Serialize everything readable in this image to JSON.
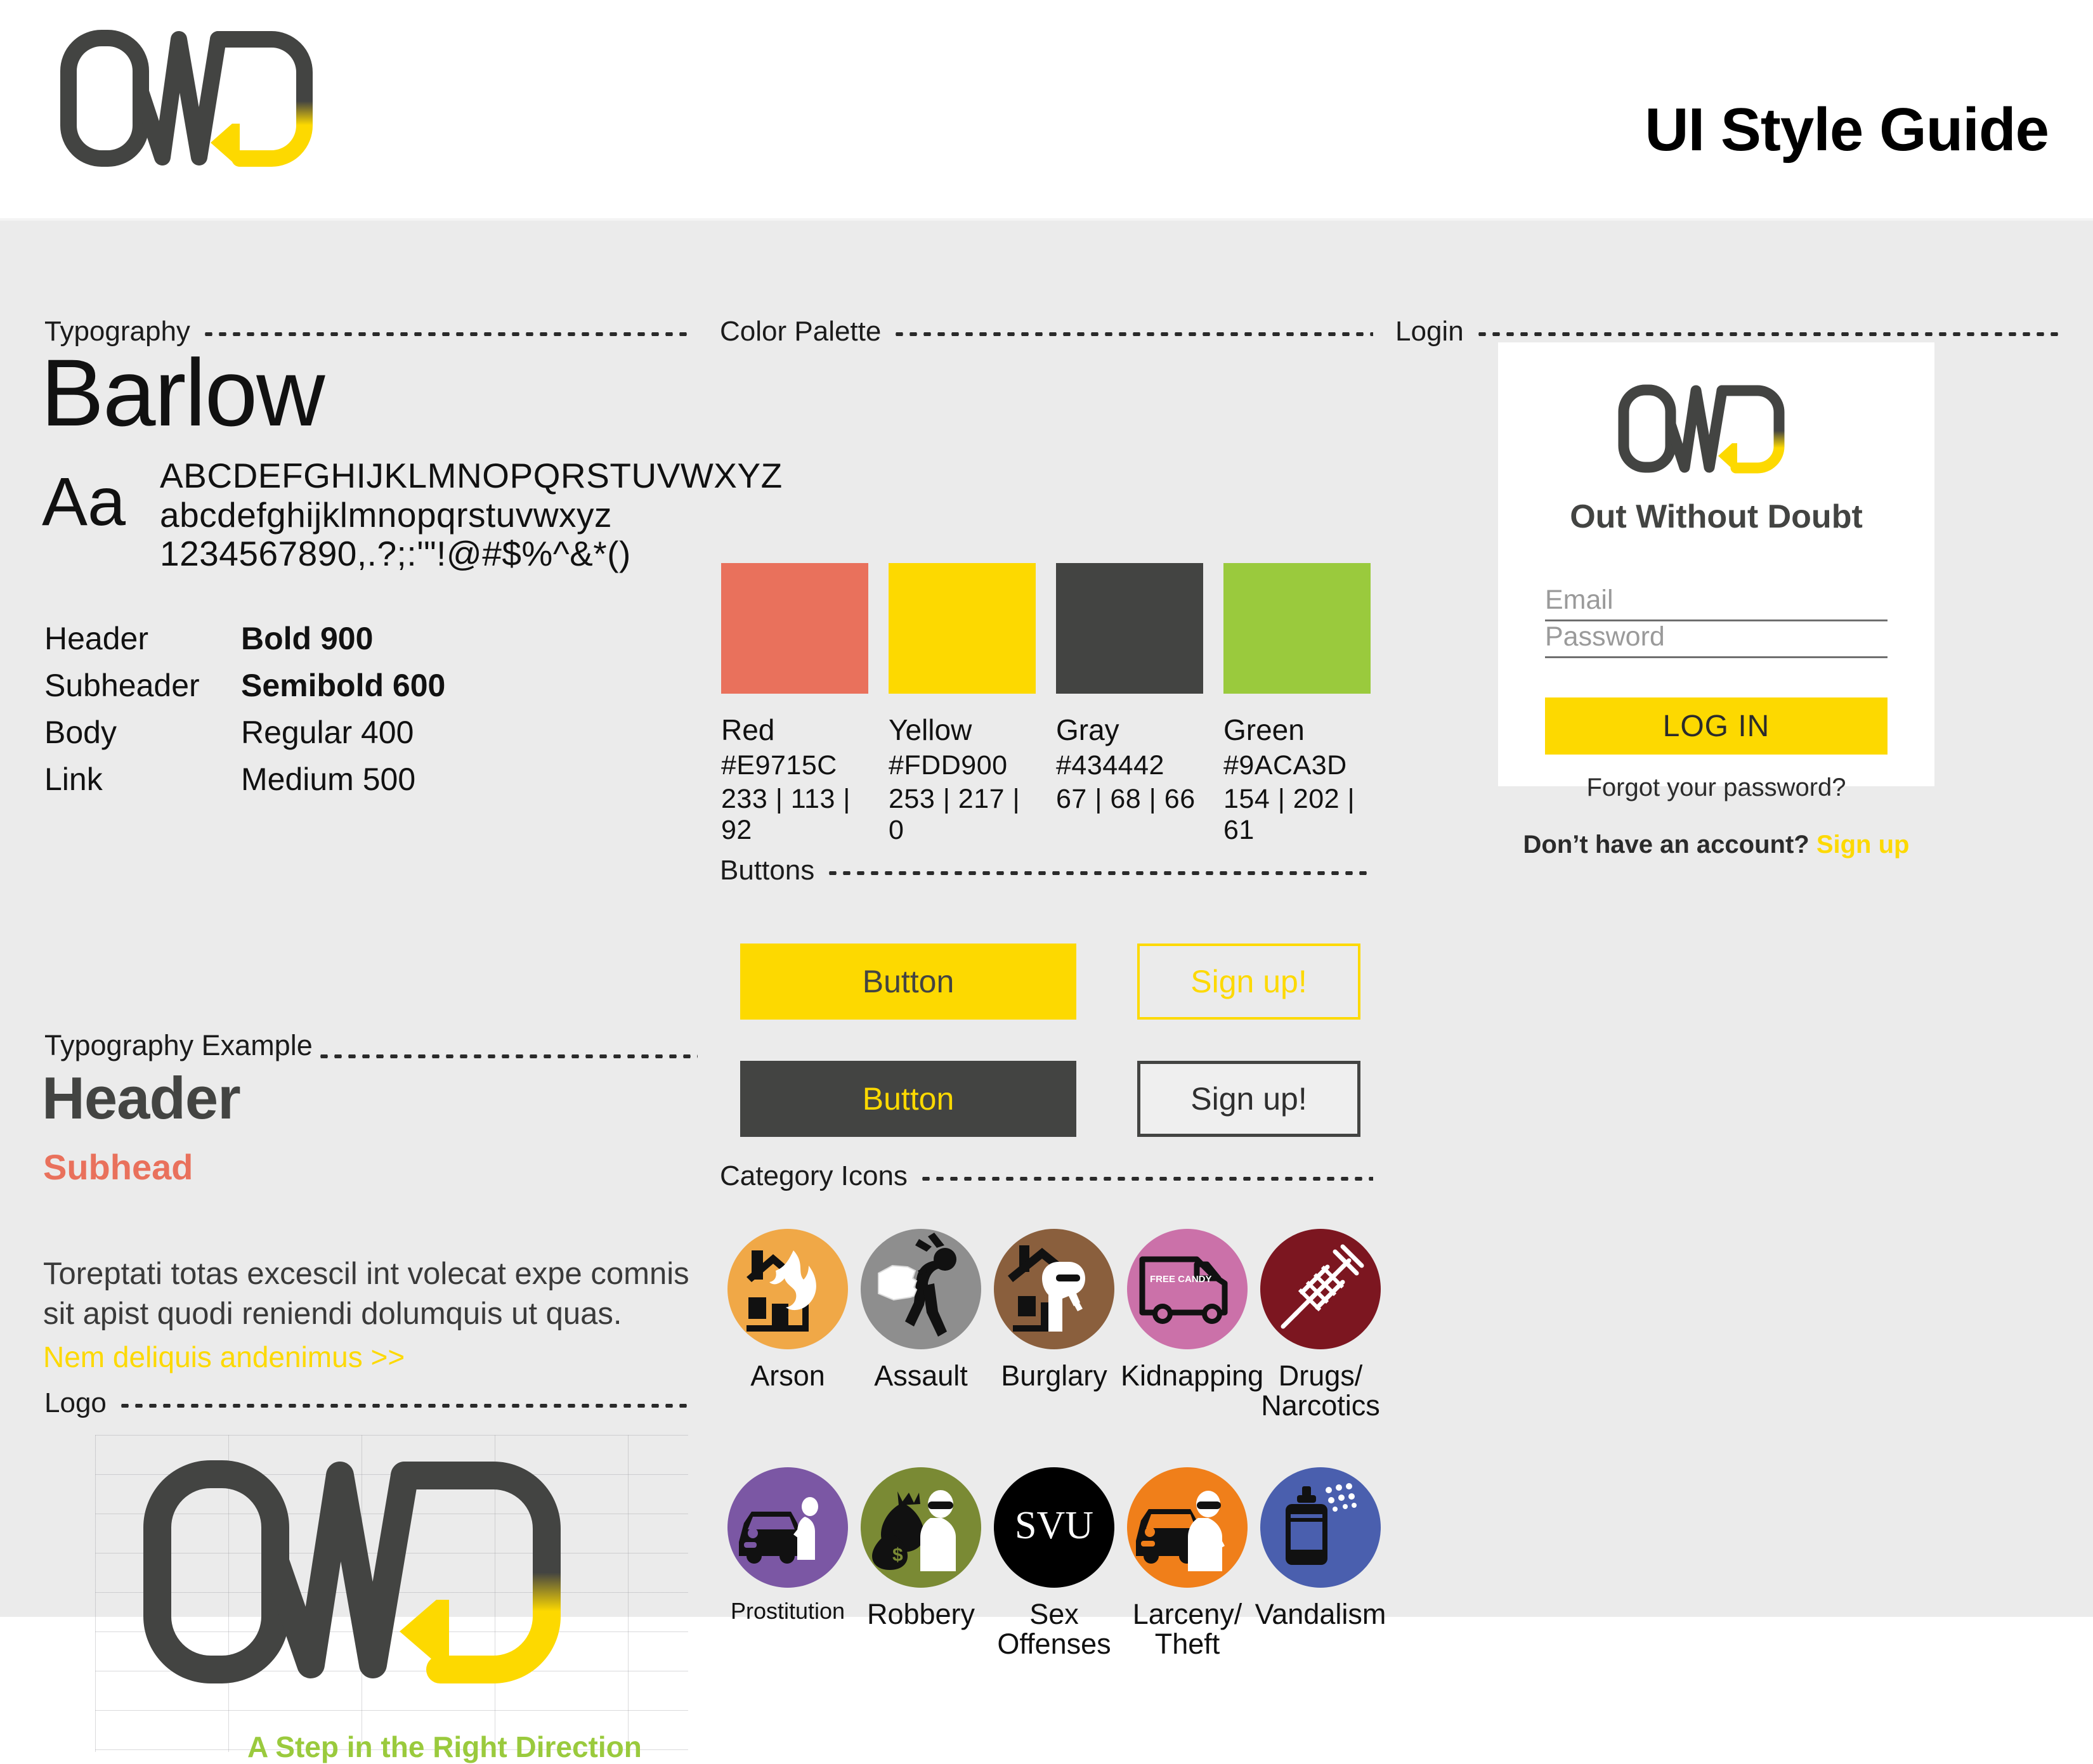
{
  "header": {
    "title": "UI Style Guide",
    "logo_alt": "owd-logo"
  },
  "sections": {
    "typography": "Typography",
    "typography_example": "Typography Example",
    "logo": "Logo",
    "color_palette": "Color Palette",
    "buttons": "Buttons",
    "category_icons": "Category Icons",
    "login": "Login"
  },
  "typography": {
    "font_name": "Barlow",
    "aa_glyph": "Aa",
    "uppercase": "ABCDEFGHIJKLMNOPQRSTUVWXYZ",
    "lowercase": "abcdefghijklmnopqrstuvwxyz",
    "numerals": "1234567890,.?;:'\"!@#$%^&*()",
    "weights": [
      {
        "role": "Header",
        "weight": "Bold 900"
      },
      {
        "role": "Subheader",
        "weight": "Semibold 600"
      },
      {
        "role": "Body",
        "weight": "Regular 400"
      },
      {
        "role": "Link",
        "weight": "Medium 500"
      }
    ],
    "example": {
      "header": "Header",
      "subhead": "Subhead",
      "body": "Toreptati totas excescil int volecat expe comnis sit apist quodi reniendi dolumquis ut quas.",
      "link": "Nem deliquis andenimus >>"
    }
  },
  "logo": {
    "tagline": "A Step in the Right Direction"
  },
  "palette": [
    {
      "name": "Red",
      "hex": "#E9715C",
      "rgb": "233 | 113 | 92"
    },
    {
      "name": "Yellow",
      "hex": "#FDD900",
      "rgb": "253 | 217 | 0"
    },
    {
      "name": "Gray",
      "hex": "#434442",
      "rgb": "67 | 68 | 66"
    },
    {
      "name": "Green",
      "hex": "#9ACA3D",
      "rgb": "154 | 202 | 61"
    }
  ],
  "buttons": {
    "primary": "Button",
    "secondary_outline": "Sign up!",
    "dark": "Button",
    "dark_outline": "Sign up!"
  },
  "category_icons": [
    {
      "label": "Arson",
      "color": "#F0A847",
      "icon": "burning-house-icon"
    },
    {
      "label": "Assault",
      "color": "#8E8E8E",
      "icon": "punch-person-icon"
    },
    {
      "label": "Burglary",
      "color": "#8A5F3D",
      "icon": "house-burglar-icon"
    },
    {
      "label": "Kidnapping",
      "color": "#CB71A9",
      "icon": "candy-van-icon",
      "van_text": "FREE CANDY"
    },
    {
      "label": "Drugs/ Narcotics",
      "color": "#7C1620",
      "icon": "syringe-icon"
    },
    {
      "label": "Prostitution",
      "color": "#7B57A4",
      "icon": "car-solicitation-icon"
    },
    {
      "label": "Robbery",
      "color": "#7A8A34",
      "icon": "money-bag-robber-icon"
    },
    {
      "label": "Sex Offenses",
      "color": "#000000",
      "icon": "svu-text-icon",
      "text": "SVU"
    },
    {
      "label": "Larceny/ Theft",
      "color": "#F07F1A",
      "icon": "car-theft-icon"
    },
    {
      "label": "Vandalism",
      "color": "#4A5FAE",
      "icon": "spray-can-icon"
    }
  ],
  "login": {
    "brand": "Out Without Doubt",
    "email_placeholder": "Email",
    "password_placeholder": "Password",
    "login_button": "LOG IN",
    "forgot": "Forgot your password?",
    "no_account_prefix": "Don’t have an account?",
    "signup_link": "Sign up"
  }
}
